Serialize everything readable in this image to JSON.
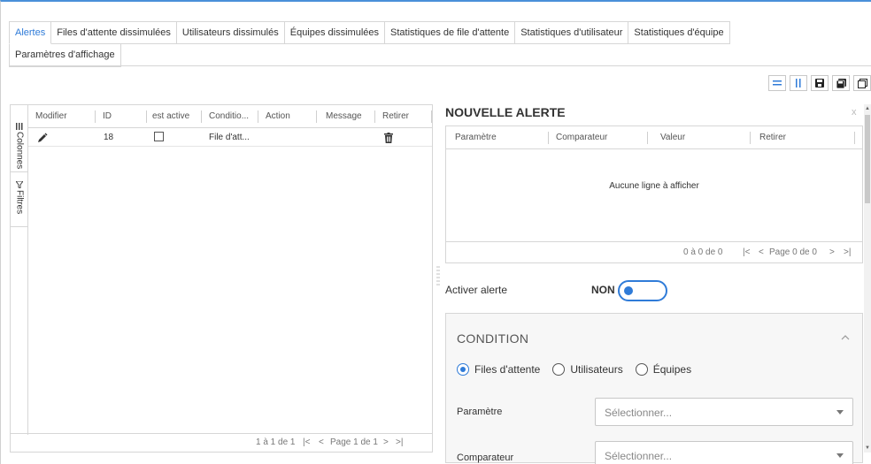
{
  "tabs": {
    "row1": [
      "Alertes",
      "Files d'attente dissimulées",
      "Utilisateurs dissimulés",
      "Équipes dissimulées",
      "Statistiques de file d'attente",
      "Statistiques d'utilisateur",
      "Statistiques d'équipe"
    ],
    "row2": [
      "Paramètres d'affichage"
    ],
    "active": "Alertes"
  },
  "toolbar": {
    "icons": [
      "rows-layout-icon",
      "columns-layout-icon",
      "save-icon",
      "save-as-icon",
      "copy-icon"
    ]
  },
  "grid": {
    "side_tabs": [
      "Colonnes",
      "Filtres"
    ],
    "columns": [
      "Modifier",
      "ID",
      "est active",
      "Conditio...",
      "Action",
      "Message",
      "Retirer"
    ],
    "rows": [
      {
        "modifier_icon": "pencil-icon",
        "id": "18",
        "est_active": false,
        "condition": "File d'att...",
        "action": "",
        "message": "",
        "retirer_icon": "trash-icon"
      }
    ],
    "footer": {
      "count": "1 à 1 de 1",
      "page": "Page 1 de 1"
    }
  },
  "panel": {
    "title": "NOUVELLE ALERTE",
    "close": "x",
    "table": {
      "columns": [
        "Paramètre",
        "Comparateur",
        "Valeur",
        "Retirer"
      ],
      "empty": "Aucune ligne à afficher",
      "footer": {
        "count": "0 à 0 de 0",
        "page": "Page 0 de 0"
      }
    },
    "activer_label": "Activer alerte",
    "toggle_state": "NON",
    "condition": {
      "title": "CONDITION",
      "radio_options": [
        "Files d'attente",
        "Utilisateurs",
        "Équipes"
      ],
      "radio_selected": "Files d'attente",
      "parametre_label": "Paramètre",
      "parametre_placeholder": "Sélectionner...",
      "comparateur_label": "Comparateur",
      "comparateur_placeholder": "Sélectionner..."
    }
  },
  "colors": {
    "accent": "#2f7bd8",
    "border": "#d6d6d6"
  }
}
